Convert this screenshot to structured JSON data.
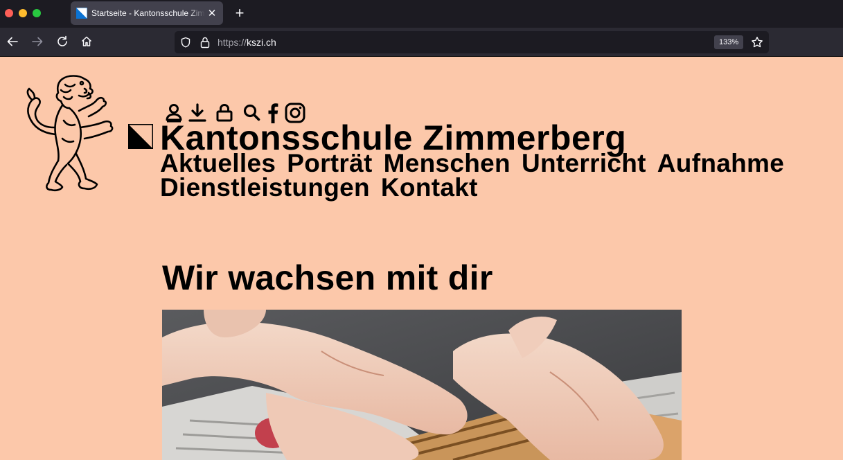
{
  "browser": {
    "tab_title": "Startseite - Kantonsschule Zimmerberg",
    "url_scheme": "https://",
    "url_host": "kszi.ch",
    "zoom": "133%",
    "new_tab_label": "+",
    "close_tab_label": "✕"
  },
  "site": {
    "title": "Kantonsschule Zimmerberg",
    "icons": [
      "user-icon",
      "download-icon",
      "lock-icon",
      "search-icon",
      "facebook-icon",
      "instagram-icon"
    ],
    "nav": [
      "Aktuelles",
      "Porträt",
      "Menschen",
      "Unterricht",
      "Aufnahme",
      "Dienstleistungen",
      "Kontakt"
    ],
    "background_color": "#fcc8aa"
  },
  "main": {
    "headline": "Wir wachsen mit dir"
  }
}
